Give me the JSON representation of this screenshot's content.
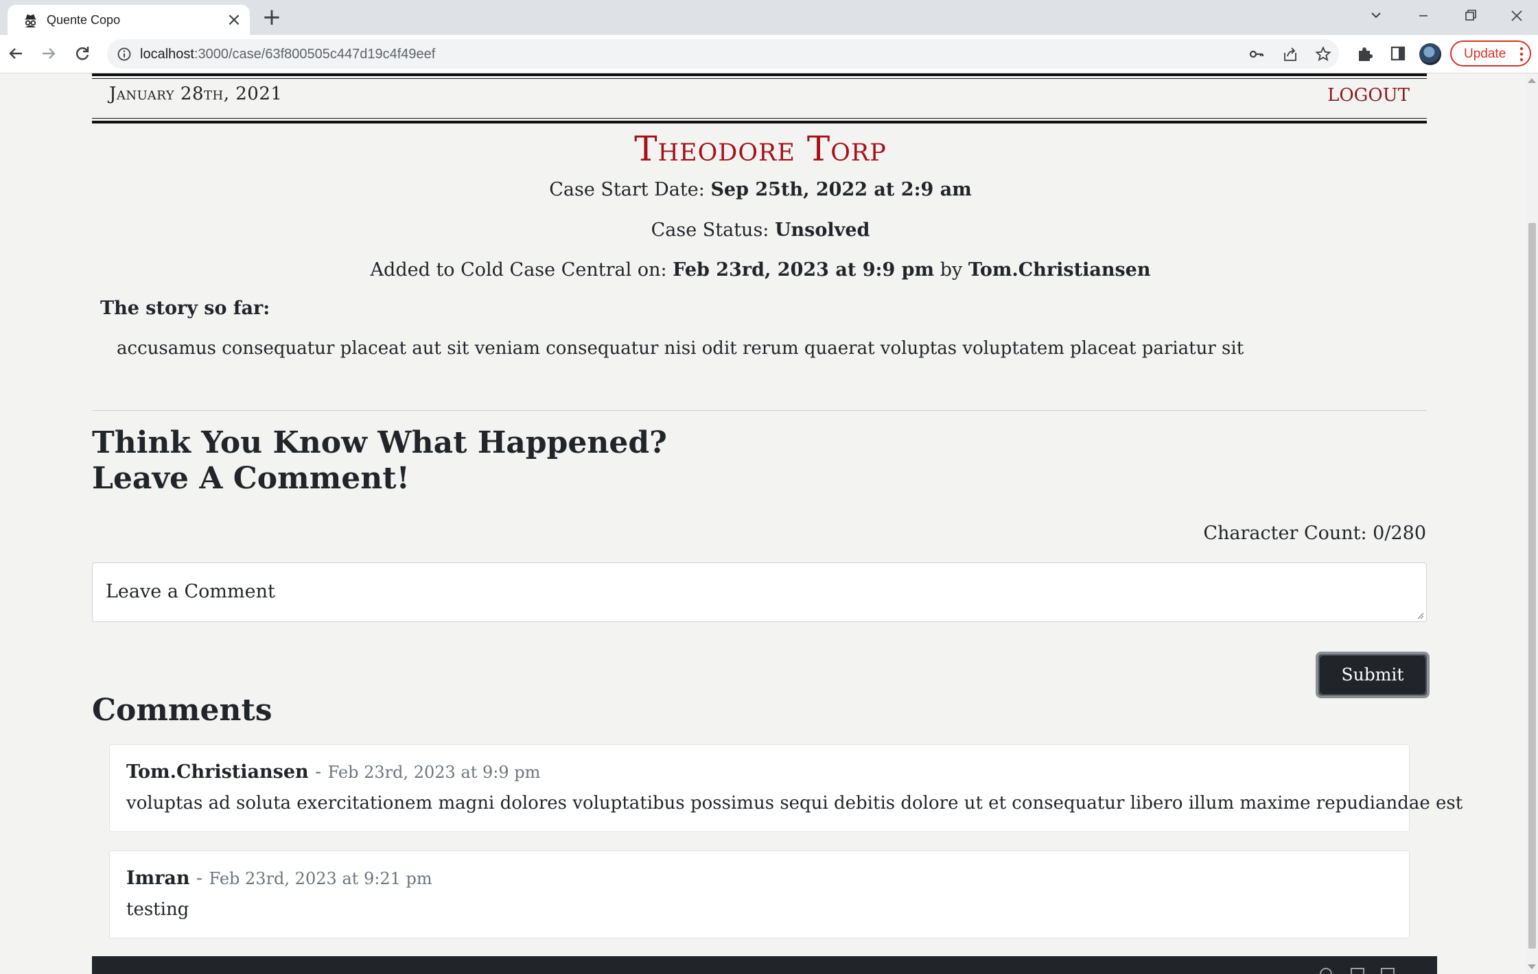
{
  "browser": {
    "tab_title": "Quente Copo",
    "url_host": "localhost",
    "url_path": ":3000/case/63f800505c447d19c4f49eef",
    "update_label": "Update"
  },
  "header": {
    "date": "January 28th, 2021",
    "logout_label": "LOGOUT"
  },
  "case": {
    "title": "Theodore Torp",
    "start_label": "Case Start Date:",
    "start_value": "Sep 25th, 2022 at 2:9 am",
    "status_label": "Case Status:",
    "status_value": "Unsolved",
    "added_label": "Added to Cold Case Central on:",
    "added_value": "Feb 23rd, 2023 at 9:9 pm",
    "by_label": "by",
    "added_by": "Tom.Christiansen",
    "story_label": "The story so far:",
    "story_text": "accusamus consequatur placeat aut sit veniam consequatur nisi odit rerum quaerat voluptas voluptatem placeat pariatur sit"
  },
  "comment_form": {
    "heading_line1": "Think You Know What Happened?",
    "heading_line2": "Leave A Comment!",
    "char_count": "Character Count: 0/280",
    "placeholder": "Leave a Comment",
    "submit_label": "Submit"
  },
  "comments": {
    "heading": "Comments",
    "items": [
      {
        "author": "Tom.Christiansen",
        "separator": "-",
        "timestamp": "Feb 23rd, 2023 at 9:9 pm",
        "text": "voluptas ad soluta exercitationem magni dolores voluptatibus possimus sequi debitis dolore ut et consequatur libero illum maxime repudiandae est"
      },
      {
        "author": "Imran",
        "separator": "-",
        "timestamp": "Feb 23rd, 2023 at 9:21 pm",
        "text": "testing"
      }
    ]
  },
  "colors": {
    "accent_red": "#a3121a",
    "page_bg": "#f3f3f2",
    "dark": "#212529"
  }
}
